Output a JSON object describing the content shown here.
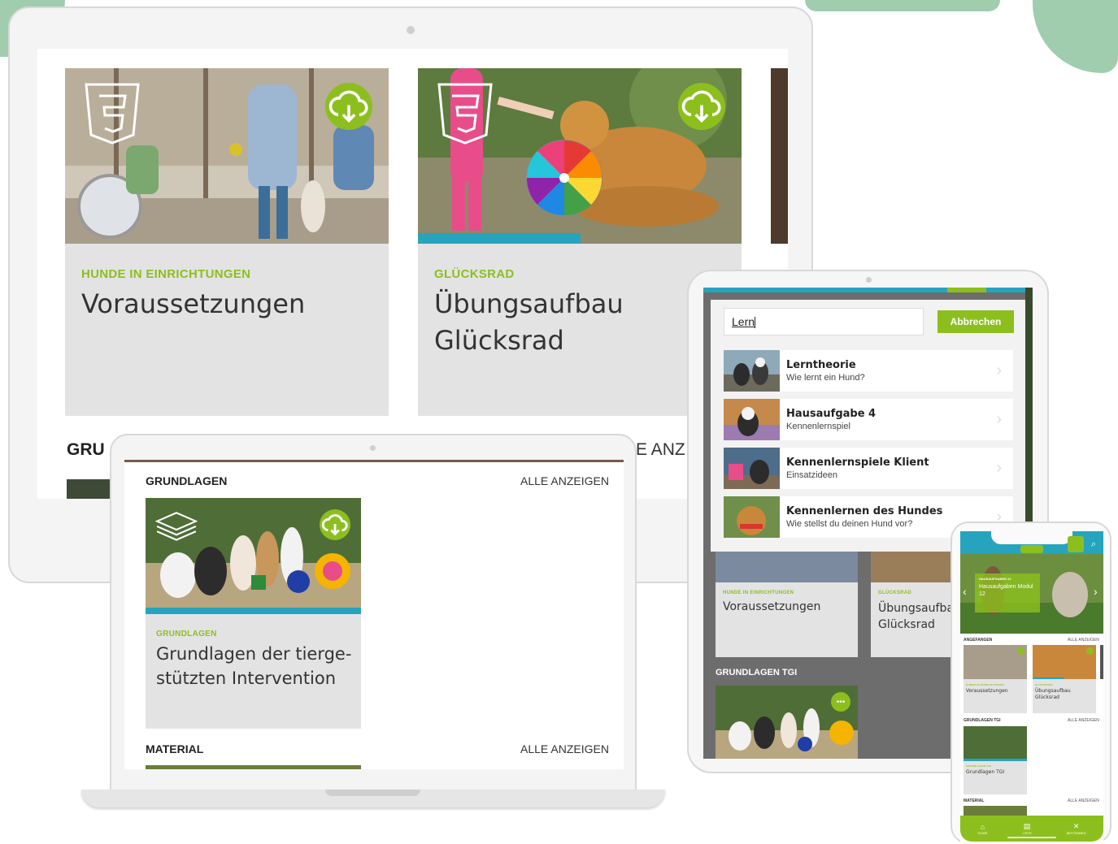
{
  "monitor": {
    "cards": [
      {
        "category": "HUNDE IN EINRICHTUNGEN",
        "title": "Voraussetzungen",
        "progress": 0
      },
      {
        "category": "GLÜCKSRAD",
        "title": "Übungsaufbau Glücksrad",
        "progress": 0.5
      }
    ],
    "section_title_partial": "GRU",
    "show_all_partial": "E ANZ"
  },
  "laptop": {
    "sections": [
      {
        "title": "GRUNDLAGEN",
        "show_all": "ALLE ANZEIGEN"
      },
      {
        "title": "MATERIAL",
        "show_all": "ALLE ANZEIGEN"
      }
    ],
    "card": {
      "category": "GRUNDLAGEN",
      "title": "Grundlagen der tierge-stützten Intervention",
      "progress": 1
    }
  },
  "tablet": {
    "search": {
      "value": "Lern",
      "cancel_label": "Abbrechen"
    },
    "results": [
      {
        "title": "Lerntheorie",
        "subtitle": "Wie lernt ein Hund?"
      },
      {
        "title": "Hausaufgabe 4",
        "subtitle": "Kennenlernspiel"
      },
      {
        "title": "Kennenlernspiele Klient",
        "subtitle": "Einsatzideen"
      },
      {
        "title": "Kennenlernen des Hundes",
        "subtitle": "Wie stellst du deinen Hund vor?"
      }
    ],
    "background_cards": [
      {
        "category": "HUNDE IN EINRICHTUNGEN",
        "title": "Voraussetzungen"
      },
      {
        "category": "GLÜCKSRAD",
        "title": "Übungsaufbau Glücksrad"
      }
    ],
    "section_title": "GRUNDLAGEN TGI"
  },
  "phone": {
    "hero": {
      "kicker": "HAUSAUFGABEN 12",
      "title": "Hausaufgaben Modul 12"
    },
    "sections": [
      {
        "title": "ANGEFANGEN",
        "show_all": "ALLE ANZEIGEN"
      },
      {
        "title": "GRUNDLAGEN TGI",
        "show_all": "ALLE ANZEIGEN"
      },
      {
        "title": "MATERIAL",
        "show_all": "ALLE ANZEIGEN"
      }
    ],
    "cards": [
      {
        "category": "HUNDE IN EINRICHTUNGEN",
        "title": "Voraussetzungen"
      },
      {
        "category": "GLÜCKSRAD",
        "title": "Übungsaufbau Glücksrad"
      },
      {
        "category": "GRUNDLAGEN TGI",
        "title": "Grundlagen TGI"
      }
    ],
    "nav": [
      {
        "label": "HOME",
        "icon": "home-icon"
      },
      {
        "label": "LISTE",
        "icon": "list-icon"
      },
      {
        "label": "BESTIMMEN",
        "icon": "dog-icon"
      }
    ]
  },
  "colors": {
    "accent": "#8cbf1e",
    "progress": "#27a4bd",
    "card_bg": "#e3e3e3",
    "teal_header": "#27a4bd"
  }
}
